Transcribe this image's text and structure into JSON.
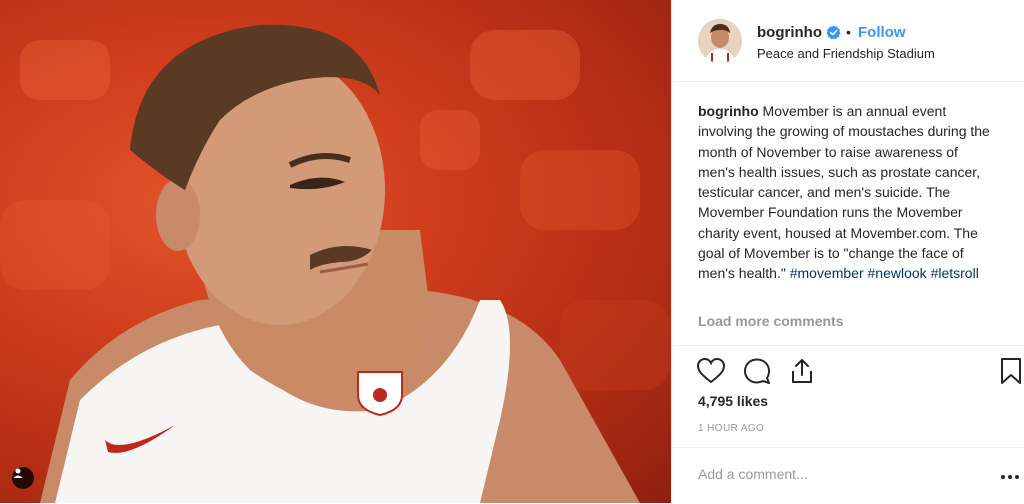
{
  "post": {
    "image_alt": "Basketball player in white Olympiacos jersey with moustache"
  },
  "header": {
    "username": "bogrinho",
    "dot": "•",
    "follow_label": "Follow",
    "location": "Peace and Friendship Stadium"
  },
  "caption": {
    "username": "bogrinho",
    "text": "Movember is an annual event involving the growing of moustaches during the month of November to raise awareness of men's health issues, such as prostate cancer, testicular cancer, and men's suicide. The Movember Foundation runs the Movember charity event, housed at Movember.com. The goal of Movember is to \"change the face of men's health.\"",
    "hashtags": [
      "#movember",
      "#newlook",
      "#letsroll"
    ]
  },
  "comments": {
    "load_more_label": "Load more comments"
  },
  "engagement": {
    "likes": "4,795 likes",
    "time_ago": "1 HOUR AGO"
  },
  "comment_box": {
    "placeholder": "Add a comment..."
  },
  "icons": {
    "like": "heart-icon",
    "comment": "comment-bubble-icon",
    "share": "share-icon",
    "save": "bookmark-icon",
    "more": "more-options-icon",
    "verified": "verified-badge-icon",
    "user_tag": "user-tag-icon"
  },
  "colors": {
    "follow": "#3897f0",
    "verified": "#3897f0",
    "muted": "#999999",
    "text": "#262626",
    "hashtag": "#003569"
  }
}
